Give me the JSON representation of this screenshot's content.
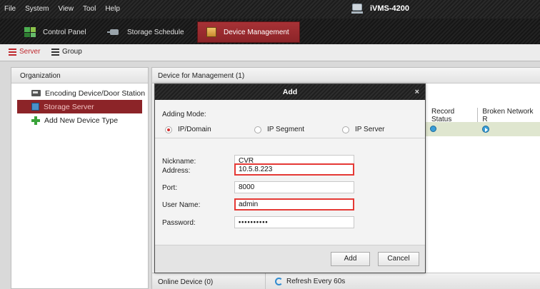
{
  "menu": [
    "File",
    "System",
    "View",
    "Tool",
    "Help"
  ],
  "app_title": "iVMS-4200",
  "module_tabs": [
    {
      "label": "Control Panel",
      "icon": "control-panel-icon"
    },
    {
      "label": "Storage Schedule",
      "icon": "storage-schedule-icon"
    },
    {
      "label": "Device Management",
      "icon": "device-management-icon",
      "active": true
    }
  ],
  "sub_tabs": [
    {
      "label": "Server",
      "icon": "server-icon",
      "active": true
    },
    {
      "label": "Group",
      "icon": "group-icon"
    }
  ],
  "organization": {
    "title": "Organization",
    "items": [
      {
        "label": "Encoding Device/Door Station",
        "icon": "encoding-device-icon"
      },
      {
        "label": "Storage Server",
        "icon": "storage-server-icon",
        "selected": true
      },
      {
        "label": "Add New Device Type",
        "icon": "add-icon"
      }
    ]
  },
  "device_panel": {
    "title": "Device for Management (1)",
    "columns": [
      "Record Status",
      "Broken Network R"
    ],
    "online_device": "Online Device (0)",
    "refresh": "Refresh Every 60s"
  },
  "dialog": {
    "title": "Add",
    "close": "×",
    "adding_mode_label": "Adding Mode:",
    "modes": [
      "IP/Domain",
      "IP Segment",
      "IP Server"
    ],
    "fields": [
      {
        "label": "Nickname:",
        "value": "CVR"
      },
      {
        "label": "Address:",
        "value": "10.5.8.223"
      },
      {
        "label": "Port:",
        "value": "8000"
      },
      {
        "label": "User Name:",
        "value": "admin"
      },
      {
        "label": "Password:",
        "value": "••••••••••"
      }
    ],
    "add_button": "Add",
    "cancel_button": "Cancel"
  },
  "colors": {
    "accent": "#8c2428",
    "highlight": "#e53935"
  }
}
